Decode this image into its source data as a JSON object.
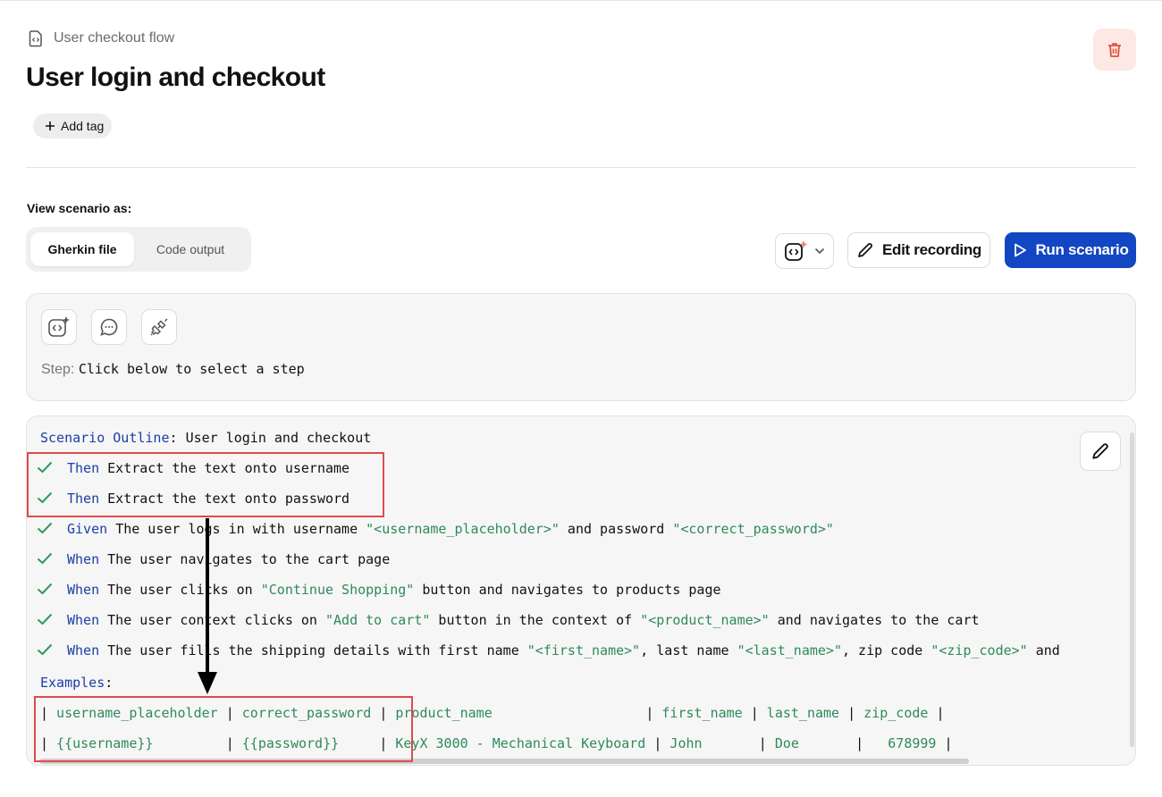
{
  "breadcrumb": {
    "icon": "file-code-icon",
    "label": "User checkout flow"
  },
  "page_title": "User login and checkout",
  "toolbar": {
    "delete_icon": "trash-icon",
    "add_tag_label": "Add tag",
    "view_label": "View scenario as:",
    "view_tabs": [
      {
        "label": "Gherkin file",
        "active": true
      },
      {
        "label": "Code output",
        "active": false
      }
    ],
    "ai_dropdown_icon": "ai-code-sparkle-icon",
    "edit_recording_label": "Edit recording",
    "run_scenario_label": "Run scenario"
  },
  "step_panel": {
    "tools": [
      "ai-code-icon",
      "chat-bubble-icon",
      "plug-disconnect-icon"
    ],
    "step_label": "Step:",
    "step_value": "Click below to select a step"
  },
  "scenario": {
    "outline_keyword": "Scenario Outline",
    "outline_title": "User login and checkout",
    "steps": [
      {
        "keyword": "Then",
        "text": "Extract the text onto username",
        "status": "passed"
      },
      {
        "keyword": "Then",
        "text": "Extract the text onto password",
        "status": "passed"
      },
      {
        "keyword": "Given",
        "text": "The user logs in with username \"<username_placeholder>\" and password \"<correct_password>\"",
        "status": "passed"
      },
      {
        "keyword": "When",
        "text": "The user navigates to the cart page",
        "status": "passed"
      },
      {
        "keyword": "When",
        "text": "The user clicks on \"Continue Shopping\" button and navigates to products page",
        "status": "passed"
      },
      {
        "keyword": "When",
        "text": "The user context clicks on \"Add to cart\" button in the context of \"<product_name>\" and navigates to the cart",
        "status": "passed"
      },
      {
        "keyword": "When",
        "text": "The user fills the shipping details with first name \"<first_name>\", last name \"<last_name>\", zip code \"<zip_code>\" and",
        "status": "passed"
      }
    ],
    "examples_keyword": "Examples",
    "examples_header": "| username_placeholder | correct_password | product_name                   | first_name | last_name | zip_code |",
    "examples_row": "| {{username}}         | {{password}}     | KeyX 3000 - Mechanical Keyboard | John       | Doe       |   678999 |",
    "edit_icon": "pencil-icon"
  },
  "colors": {
    "keyword": "#1a3fa6",
    "string": "#2f8a5a",
    "check": "#2e9a5b",
    "primary": "#1346c2",
    "highlight": "#e04b4b"
  }
}
